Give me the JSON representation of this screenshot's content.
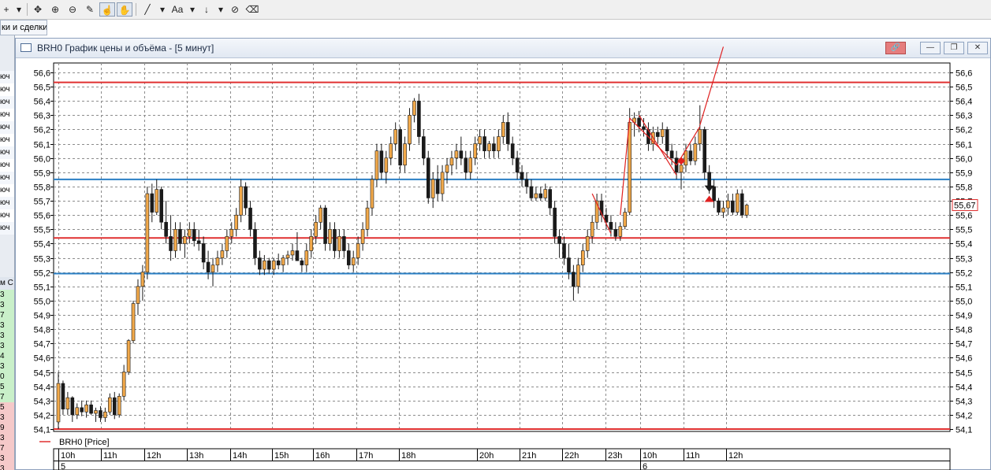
{
  "toolbar": {
    "tools": [
      {
        "name": "crosshair-tool-button",
        "glyph": "+"
      },
      {
        "name": "crosshair-dropdown-button",
        "glyph": "▾"
      },
      {
        "name": "move-tool-button",
        "glyph": "✥"
      },
      {
        "name": "zoom-in-button",
        "glyph": "⊕"
      },
      {
        "name": "zoom-out-button",
        "glyph": "⊖"
      },
      {
        "name": "ruler-tool-button",
        "glyph": "✎"
      },
      {
        "name": "hand-tool-button",
        "glyph": "☝"
      },
      {
        "name": "grab-tool-button",
        "glyph": "✋"
      },
      {
        "name": "line-tool-button",
        "glyph": "╱"
      },
      {
        "name": "line-dropdown-button",
        "glyph": "▾"
      },
      {
        "name": "text-tool-button",
        "glyph": "Aa"
      },
      {
        "name": "text-dropdown-button",
        "glyph": "▾"
      },
      {
        "name": "arrow-tool-button",
        "glyph": "↓"
      },
      {
        "name": "arrow-dropdown-button",
        "glyph": "▾"
      },
      {
        "name": "hide-drawings-button",
        "glyph": "⊘"
      },
      {
        "name": "clear-drawings-button",
        "glyph": "⌫"
      }
    ]
  },
  "left_panel": {
    "tab_label": "ки и сделки",
    "row_label": "юч",
    "header_label": "м С",
    "digits": [
      "3",
      "3",
      "7",
      "3",
      "3",
      "3",
      "4",
      "3",
      "0",
      "5",
      "7",
      "5",
      "3",
      "9",
      "3",
      "7",
      "3",
      "3"
    ]
  },
  "window": {
    "title": "BRH0 График цены и объёма - [5 минут]",
    "buttons": {
      "link": "🔗",
      "minimize": "—",
      "restore": "❐",
      "close": "✕"
    }
  },
  "chart_data": {
    "type": "candlestick",
    "title": "",
    "series_name": "BRH0 [Price]",
    "ylim": [
      54.1,
      56.6
    ],
    "y_ticks": [
      "56,6",
      "56,5",
      "56,4",
      "56,3",
      "56,2",
      "56,1",
      "56,0",
      "55,9",
      "55,8",
      "55,7",
      "55,6",
      "55,5",
      "55,4",
      "55,3",
      "55,2",
      "55,1",
      "55,0",
      "54,9",
      "54,8",
      "54,7",
      "54,6",
      "54,5",
      "54,4",
      "54,3",
      "54,2",
      "54,1"
    ],
    "x_time_labels": [
      "10h",
      "11h",
      "12h",
      "13h",
      "14h",
      "15h",
      "16h",
      "17h",
      "18h",
      "20h",
      "21h",
      "22h",
      "23h",
      "10h",
      "11h",
      "12h"
    ],
    "x_date_labels": [
      {
        "label": "5",
        "at": "10h"
      },
      {
        "label": "6",
        "at": "10h (second)"
      }
    ],
    "last_price_label": "55,67",
    "last_price": 55.67,
    "horizontal_lines": [
      {
        "value": 56.53,
        "color": "#e03030"
      },
      {
        "value": 55.85,
        "color": "#2a7fc4"
      },
      {
        "value": 55.44,
        "color": "#e03030"
      },
      {
        "value": 55.19,
        "color": "#2a7fc4"
      },
      {
        "value": 54.1,
        "color": "#e03030"
      }
    ],
    "grid": true,
    "colors": {
      "up": "#f2a94a",
      "down": "#1a1a1a",
      "level_red": "#e03030",
      "level_blue": "#2a7fc4",
      "drawing": "#e02020"
    },
    "candles": [
      {
        "o": 54.15,
        "h": 54.5,
        "l": 54.1,
        "c": 54.42
      },
      {
        "o": 54.42,
        "h": 54.44,
        "l": 54.2,
        "c": 54.24
      },
      {
        "o": 54.24,
        "h": 54.36,
        "l": 54.2,
        "c": 54.32
      },
      {
        "o": 54.32,
        "h": 54.33,
        "l": 54.15,
        "c": 54.2
      },
      {
        "o": 54.2,
        "h": 54.28,
        "l": 54.17,
        "c": 54.25
      },
      {
        "o": 54.25,
        "h": 54.3,
        "l": 54.19,
        "c": 54.22
      },
      {
        "o": 54.22,
        "h": 54.3,
        "l": 54.18,
        "c": 54.27
      },
      {
        "o": 54.27,
        "h": 54.3,
        "l": 54.2,
        "c": 54.21
      },
      {
        "o": 54.21,
        "h": 54.25,
        "l": 54.15,
        "c": 54.23
      },
      {
        "o": 54.23,
        "h": 54.26,
        "l": 54.15,
        "c": 54.18
      },
      {
        "o": 54.18,
        "h": 54.25,
        "l": 54.15,
        "c": 54.22
      },
      {
        "o": 54.22,
        "h": 54.35,
        "l": 54.2,
        "c": 54.32
      },
      {
        "o": 54.32,
        "h": 54.36,
        "l": 54.17,
        "c": 54.2
      },
      {
        "o": 54.2,
        "h": 54.35,
        "l": 54.18,
        "c": 54.33
      },
      {
        "o": 54.33,
        "h": 54.55,
        "l": 54.3,
        "c": 54.5
      },
      {
        "o": 54.5,
        "h": 54.73,
        "l": 54.48,
        "c": 54.72
      },
      {
        "o": 54.72,
        "h": 55.0,
        "l": 54.7,
        "c": 54.98
      },
      {
        "o": 54.98,
        "h": 55.15,
        "l": 54.9,
        "c": 55.1
      },
      {
        "o": 55.1,
        "h": 55.25,
        "l": 55.0,
        "c": 55.2
      },
      {
        "o": 55.2,
        "h": 55.8,
        "l": 55.15,
        "c": 55.75
      },
      {
        "o": 55.75,
        "h": 55.82,
        "l": 55.55,
        "c": 55.62
      },
      {
        "o": 55.62,
        "h": 55.85,
        "l": 55.6,
        "c": 55.78
      },
      {
        "o": 55.78,
        "h": 55.8,
        "l": 55.5,
        "c": 55.55
      },
      {
        "o": 55.55,
        "h": 55.7,
        "l": 55.4,
        "c": 55.45
      },
      {
        "o": 55.45,
        "h": 55.6,
        "l": 55.28,
        "c": 55.35
      },
      {
        "o": 55.35,
        "h": 55.55,
        "l": 55.3,
        "c": 55.5
      },
      {
        "o": 55.5,
        "h": 55.55,
        "l": 55.35,
        "c": 55.4
      },
      {
        "o": 55.4,
        "h": 55.5,
        "l": 55.3,
        "c": 55.45
      },
      {
        "o": 55.45,
        "h": 55.55,
        "l": 55.4,
        "c": 55.5
      },
      {
        "o": 55.5,
        "h": 55.55,
        "l": 55.38,
        "c": 55.42
      },
      {
        "o": 55.42,
        "h": 55.5,
        "l": 55.35,
        "c": 55.4
      },
      {
        "o": 55.4,
        "h": 55.45,
        "l": 55.22,
        "c": 55.27
      },
      {
        "o": 55.27,
        "h": 55.35,
        "l": 55.15,
        "c": 55.2
      },
      {
        "o": 55.2,
        "h": 55.3,
        "l": 55.1,
        "c": 55.25
      },
      {
        "o": 55.25,
        "h": 55.35,
        "l": 55.2,
        "c": 55.3
      },
      {
        "o": 55.3,
        "h": 55.4,
        "l": 55.25,
        "c": 55.35
      },
      {
        "o": 55.35,
        "h": 55.5,
        "l": 55.3,
        "c": 55.45
      },
      {
        "o": 55.45,
        "h": 55.55,
        "l": 55.4,
        "c": 55.5
      },
      {
        "o": 55.5,
        "h": 55.65,
        "l": 55.45,
        "c": 55.6
      },
      {
        "o": 55.6,
        "h": 55.85,
        "l": 55.55,
        "c": 55.8
      },
      {
        "o": 55.8,
        "h": 55.83,
        "l": 55.6,
        "c": 55.65
      },
      {
        "o": 55.65,
        "h": 55.7,
        "l": 55.45,
        "c": 55.5
      },
      {
        "o": 55.5,
        "h": 55.55,
        "l": 55.25,
        "c": 55.3
      },
      {
        "o": 55.3,
        "h": 55.35,
        "l": 55.18,
        "c": 55.22
      },
      {
        "o": 55.22,
        "h": 55.32,
        "l": 55.18,
        "c": 55.28
      },
      {
        "o": 55.28,
        "h": 55.3,
        "l": 55.19,
        "c": 55.22
      },
      {
        "o": 55.22,
        "h": 55.3,
        "l": 55.18,
        "c": 55.28
      },
      {
        "o": 55.28,
        "h": 55.33,
        "l": 55.22,
        "c": 55.25
      },
      {
        "o": 55.25,
        "h": 55.32,
        "l": 55.2,
        "c": 55.3
      },
      {
        "o": 55.3,
        "h": 55.35,
        "l": 55.25,
        "c": 55.32
      },
      {
        "o": 55.32,
        "h": 55.4,
        "l": 55.28,
        "c": 55.35
      },
      {
        "o": 55.35,
        "h": 55.48,
        "l": 55.3,
        "c": 55.28
      },
      {
        "o": 55.28,
        "h": 55.3,
        "l": 55.2,
        "c": 55.25
      },
      {
        "o": 55.25,
        "h": 55.4,
        "l": 55.2,
        "c": 55.35
      },
      {
        "o": 55.35,
        "h": 55.5,
        "l": 55.3,
        "c": 55.45
      },
      {
        "o": 55.45,
        "h": 55.6,
        "l": 55.4,
        "c": 55.55
      },
      {
        "o": 55.55,
        "h": 55.67,
        "l": 55.5,
        "c": 55.65
      },
      {
        "o": 55.65,
        "h": 55.67,
        "l": 55.35,
        "c": 55.4
      },
      {
        "o": 55.4,
        "h": 55.55,
        "l": 55.35,
        "c": 55.5
      },
      {
        "o": 55.5,
        "h": 55.55,
        "l": 55.3,
        "c": 55.35
      },
      {
        "o": 55.35,
        "h": 55.5,
        "l": 55.3,
        "c": 55.45
      },
      {
        "o": 55.45,
        "h": 55.5,
        "l": 55.3,
        "c": 55.35
      },
      {
        "o": 55.35,
        "h": 55.4,
        "l": 55.22,
        "c": 55.25
      },
      {
        "o": 55.25,
        "h": 55.35,
        "l": 55.2,
        "c": 55.3
      },
      {
        "o": 55.3,
        "h": 55.45,
        "l": 55.25,
        "c": 55.4
      },
      {
        "o": 55.4,
        "h": 55.55,
        "l": 55.35,
        "c": 55.5
      },
      {
        "o": 55.5,
        "h": 55.7,
        "l": 55.45,
        "c": 55.65
      },
      {
        "o": 55.65,
        "h": 55.88,
        "l": 55.6,
        "c": 55.85
      },
      {
        "o": 55.85,
        "h": 56.1,
        "l": 55.8,
        "c": 56.05
      },
      {
        "o": 56.05,
        "h": 56.1,
        "l": 55.85,
        "c": 55.9
      },
      {
        "o": 55.9,
        "h": 56.05,
        "l": 55.82,
        "c": 56.0
      },
      {
        "o": 56.0,
        "h": 56.15,
        "l": 55.95,
        "c": 56.1
      },
      {
        "o": 56.1,
        "h": 56.25,
        "l": 56.05,
        "c": 56.2
      },
      {
        "o": 56.2,
        "h": 56.22,
        "l": 55.9,
        "c": 55.95
      },
      {
        "o": 55.95,
        "h": 56.15,
        "l": 55.9,
        "c": 56.1
      },
      {
        "o": 56.1,
        "h": 56.35,
        "l": 56.05,
        "c": 56.3
      },
      {
        "o": 56.3,
        "h": 56.42,
        "l": 56.25,
        "c": 56.4
      },
      {
        "o": 56.4,
        "h": 56.45,
        "l": 56.1,
        "c": 56.15
      },
      {
        "o": 56.15,
        "h": 56.2,
        "l": 55.95,
        "c": 56.0
      },
      {
        "o": 56.0,
        "h": 56.05,
        "l": 55.68,
        "c": 55.72
      },
      {
        "o": 55.72,
        "h": 55.9,
        "l": 55.65,
        "c": 55.85
      },
      {
        "o": 55.85,
        "h": 55.95,
        "l": 55.7,
        "c": 55.75
      },
      {
        "o": 55.75,
        "h": 55.95,
        "l": 55.7,
        "c": 55.9
      },
      {
        "o": 55.9,
        "h": 56.0,
        "l": 55.82,
        "c": 55.95
      },
      {
        "o": 55.95,
        "h": 56.05,
        "l": 55.88,
        "c": 56.0
      },
      {
        "o": 56.0,
        "h": 56.1,
        "l": 55.92,
        "c": 56.05
      },
      {
        "o": 56.05,
        "h": 56.15,
        "l": 55.95,
        "c": 56.0
      },
      {
        "o": 56.0,
        "h": 56.05,
        "l": 55.85,
        "c": 55.9
      },
      {
        "o": 55.9,
        "h": 56.05,
        "l": 55.85,
        "c": 56.0
      },
      {
        "o": 56.0,
        "h": 56.15,
        "l": 55.95,
        "c": 56.1
      },
      {
        "o": 56.1,
        "h": 56.2,
        "l": 56.05,
        "c": 56.15
      },
      {
        "o": 56.15,
        "h": 56.2,
        "l": 56.0,
        "c": 56.05
      },
      {
        "o": 56.05,
        "h": 56.12,
        "l": 56.0,
        "c": 56.1
      },
      {
        "o": 56.1,
        "h": 56.15,
        "l": 56.0,
        "c": 56.05
      },
      {
        "o": 56.05,
        "h": 56.2,
        "l": 56.0,
        "c": 56.15
      },
      {
        "o": 56.15,
        "h": 56.3,
        "l": 56.1,
        "c": 56.25
      },
      {
        "o": 56.25,
        "h": 56.32,
        "l": 56.05,
        "c": 56.1
      },
      {
        "o": 56.1,
        "h": 56.15,
        "l": 55.95,
        "c": 56.0
      },
      {
        "o": 56.0,
        "h": 56.05,
        "l": 55.85,
        "c": 55.9
      },
      {
        "o": 55.9,
        "h": 55.95,
        "l": 55.8,
        "c": 55.85
      },
      {
        "o": 55.85,
        "h": 55.9,
        "l": 55.75,
        "c": 55.8
      },
      {
        "o": 55.8,
        "h": 55.85,
        "l": 55.7,
        "c": 55.72
      },
      {
        "o": 55.72,
        "h": 55.8,
        "l": 55.7,
        "c": 55.75
      },
      {
        "o": 55.75,
        "h": 55.8,
        "l": 55.7,
        "c": 55.72
      },
      {
        "o": 55.72,
        "h": 55.82,
        "l": 55.7,
        "c": 55.78
      },
      {
        "o": 55.78,
        "h": 55.8,
        "l": 55.6,
        "c": 55.65
      },
      {
        "o": 55.65,
        "h": 55.7,
        "l": 55.4,
        "c": 55.45
      },
      {
        "o": 55.45,
        "h": 55.5,
        "l": 55.3,
        "c": 55.4
      },
      {
        "o": 55.4,
        "h": 55.45,
        "l": 55.25,
        "c": 55.3
      },
      {
        "o": 55.3,
        "h": 55.4,
        "l": 55.15,
        "c": 55.2
      },
      {
        "o": 55.2,
        "h": 55.25,
        "l": 55.0,
        "c": 55.1
      },
      {
        "o": 55.1,
        "h": 55.3,
        "l": 55.05,
        "c": 55.25
      },
      {
        "o": 55.25,
        "h": 55.4,
        "l": 55.2,
        "c": 55.35
      },
      {
        "o": 55.35,
        "h": 55.5,
        "l": 55.3,
        "c": 55.45
      },
      {
        "o": 55.45,
        "h": 55.6,
        "l": 55.4,
        "c": 55.55
      },
      {
        "o": 55.55,
        "h": 55.75,
        "l": 55.5,
        "c": 55.7
      },
      {
        "o": 55.7,
        "h": 55.75,
        "l": 55.55,
        "c": 55.6
      },
      {
        "o": 55.6,
        "h": 55.65,
        "l": 55.5,
        "c": 55.55
      },
      {
        "o": 55.55,
        "h": 55.6,
        "l": 55.45,
        "c": 55.5
      },
      {
        "o": 55.5,
        "h": 55.55,
        "l": 55.42,
        "c": 55.45
      },
      {
        "o": 55.45,
        "h": 55.55,
        "l": 55.42,
        "c": 55.52
      },
      {
        "o": 55.52,
        "h": 55.65,
        "l": 55.5,
        "c": 55.62
      },
      {
        "o": 55.62,
        "h": 56.35,
        "l": 55.6,
        "c": 56.25
      },
      {
        "o": 56.25,
        "h": 56.32,
        "l": 56.15,
        "c": 56.28
      },
      {
        "o": 56.28,
        "h": 56.33,
        "l": 56.18,
        "c": 56.22
      },
      {
        "o": 56.22,
        "h": 56.28,
        "l": 56.15,
        "c": 56.2
      },
      {
        "o": 56.2,
        "h": 56.25,
        "l": 56.05,
        "c": 56.1
      },
      {
        "o": 56.1,
        "h": 56.22,
        "l": 56.05,
        "c": 56.18
      },
      {
        "o": 56.18,
        "h": 56.22,
        "l": 56.1,
        "c": 56.15
      },
      {
        "o": 56.15,
        "h": 56.25,
        "l": 56.1,
        "c": 56.2
      },
      {
        "o": 56.2,
        "h": 56.22,
        "l": 56.0,
        "c": 56.05
      },
      {
        "o": 56.05,
        "h": 56.1,
        "l": 55.95,
        "c": 56.0
      },
      {
        "o": 56.0,
        "h": 56.05,
        "l": 55.85,
        "c": 55.9
      },
      {
        "o": 55.9,
        "h": 56.0,
        "l": 55.78,
        "c": 55.95
      },
      {
        "o": 55.95,
        "h": 56.1,
        "l": 55.9,
        "c": 56.05
      },
      {
        "o": 56.05,
        "h": 56.1,
        "l": 55.95,
        "c": 55.98
      },
      {
        "o": 55.98,
        "h": 56.15,
        "l": 55.95,
        "c": 56.1
      },
      {
        "o": 56.1,
        "h": 56.37,
        "l": 56.05,
        "c": 56.2
      },
      {
        "o": 56.2,
        "h": 56.22,
        "l": 55.85,
        "c": 55.9
      },
      {
        "o": 55.9,
        "h": 55.95,
        "l": 55.75,
        "c": 55.8
      },
      {
        "o": 55.8,
        "h": 55.85,
        "l": 55.65,
        "c": 55.7
      },
      {
        "o": 55.7,
        "h": 55.72,
        "l": 55.6,
        "c": 55.62
      },
      {
        "o": 55.62,
        "h": 55.7,
        "l": 55.58,
        "c": 55.65
      },
      {
        "o": 55.65,
        "h": 55.75,
        "l": 55.6,
        "c": 55.7
      },
      {
        "o": 55.7,
        "h": 55.75,
        "l": 55.6,
        "c": 55.62
      },
      {
        "o": 55.62,
        "h": 55.78,
        "l": 55.6,
        "c": 55.75
      },
      {
        "o": 55.75,
        "h": 55.78,
        "l": 55.58,
        "c": 55.6
      },
      {
        "o": 55.6,
        "h": 55.68,
        "l": 55.58,
        "c": 55.67
      }
    ],
    "drawings": {
      "trend_lines": [
        {
          "from": {
            "bar": 137,
            "price": 56.23
          },
          "to": {
            "bar": 142,
            "price": 56.78
          }
        },
        {
          "from": {
            "bar": 114,
            "price": 55.75
          },
          "to": {
            "bar": 118,
            "price": 55.47
          }
        },
        {
          "from": {
            "bar": 120,
            "price": 55.6
          },
          "to": {
            "bar": 122,
            "price": 56.28
          }
        },
        {
          "from": {
            "bar": 122,
            "price": 56.28
          },
          "to": {
            "bar": 132,
            "price": 55.95
          }
        },
        {
          "from": {
            "bar": 124,
            "price": 56.3
          },
          "to": {
            "bar": 132,
            "price": 55.88
          }
        },
        {
          "from": {
            "bar": 132,
            "price": 55.95
          },
          "to": {
            "bar": 137,
            "price": 56.22
          }
        }
      ],
      "markers": [
        {
          "bar": 133,
          "price": 55.98,
          "kind": "diamond",
          "color": "#e02020"
        },
        {
          "bar": 139,
          "price": 55.78,
          "kind": "down-triangle",
          "color": "#1a1a1a"
        },
        {
          "bar": 139,
          "price": 55.72,
          "kind": "up-triangle",
          "color": "#e02020"
        }
      ]
    }
  }
}
